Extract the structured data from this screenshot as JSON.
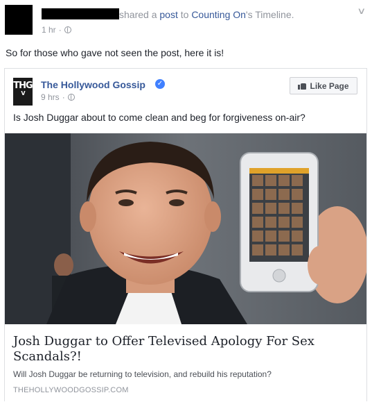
{
  "header": {
    "action_text": "shared a ",
    "post_link": "post",
    "to_text": " to ",
    "timeline_owner": "Counting On",
    "timeline_suffix": "'s Timeline.",
    "time": "1 hr",
    "separator": "·",
    "privacy_icon": "globe-icon",
    "menu_icon": "chevron-down-icon"
  },
  "post": {
    "text": "So for those who gave not seen the post, here it is!"
  },
  "shared": {
    "page_logo_text": "THG",
    "page_logo_sub": "V",
    "page_name": "The Hollywood Gossip",
    "verified_icon": "verified-badge-icon",
    "time": "9 hrs",
    "separator": "·",
    "like_button_label": "Like Page",
    "text": "Is Josh Duggar about to come clean and beg for forgiveness on-air?"
  },
  "link_preview": {
    "title": "Josh Duggar to Offer Televised Apology For Sex Scandals?!",
    "description": "Will Josh Duggar be returning to television, and rebuild his reputation?",
    "domain": "THEHOLLYWOODGOSSIP.COM"
  },
  "colors": {
    "link_blue": "#365899",
    "meta_gray": "#90949c",
    "border": "#dddfe2",
    "verified_blue": "#4080ff"
  }
}
